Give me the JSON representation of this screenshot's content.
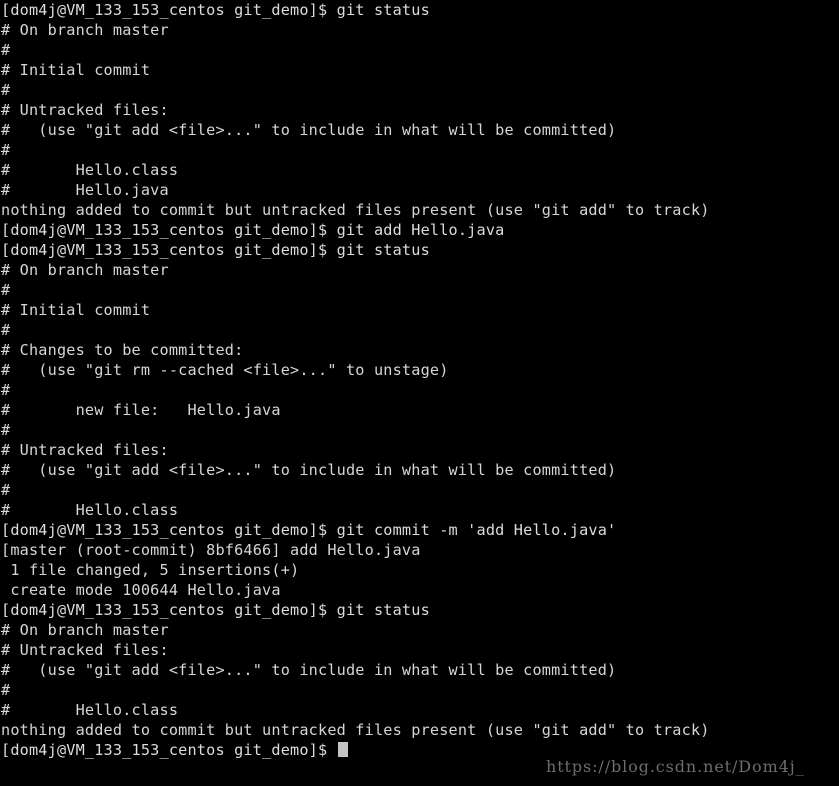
{
  "terminal": {
    "prompt": "[dom4j@VM_133_153_centos git_demo]$ ",
    "background_color": "#000000",
    "text_color": "#d6d6d6",
    "cursor_color": "#c3c3c8",
    "lines": [
      "[dom4j@VM_133_153_centos git_demo]$ git status",
      "# On branch master",
      "#",
      "# Initial commit",
      "#",
      "# Untracked files:",
      "#   (use \"git add <file>...\" to include in what will be committed)",
      "#",
      "#       Hello.class",
      "#       Hello.java",
      "nothing added to commit but untracked files present (use \"git add\" to track)",
      "[dom4j@VM_133_153_centos git_demo]$ git add Hello.java",
      "[dom4j@VM_133_153_centos git_demo]$ git status",
      "# On branch master",
      "#",
      "# Initial commit",
      "#",
      "# Changes to be committed:",
      "#   (use \"git rm --cached <file>...\" to unstage)",
      "#",
      "#       new file:   Hello.java",
      "#",
      "# Untracked files:",
      "#   (use \"git add <file>...\" to include in what will be committed)",
      "#",
      "#       Hello.class",
      "[dom4j@VM_133_153_centos git_demo]$ git commit -m 'add Hello.java'",
      "[master (root-commit) 8bf6466] add Hello.java",
      " 1 file changed, 5 insertions(+)",
      " create mode 100644 Hello.java",
      "[dom4j@VM_133_153_centos git_demo]$ git status",
      "# On branch master",
      "# Untracked files:",
      "#   (use \"git add <file>...\" to include in what will be committed)",
      "#",
      "#       Hello.class",
      "nothing added to commit but untracked files present (use \"git add\" to track)"
    ],
    "final_prompt": "[dom4j@VM_133_153_centos git_demo]$ ",
    "commit_hash": "8bf6466",
    "branch": "master",
    "files": [
      "Hello.class",
      "Hello.java"
    ],
    "commit_message": "add Hello.java",
    "file_mode": "100644",
    "insertions": "5 insertions(+)",
    "files_changed": "1 file changed"
  },
  "watermark": {
    "text": "https://blog.csdn.net/Dom4j_",
    "color": "#6d6d6d"
  }
}
